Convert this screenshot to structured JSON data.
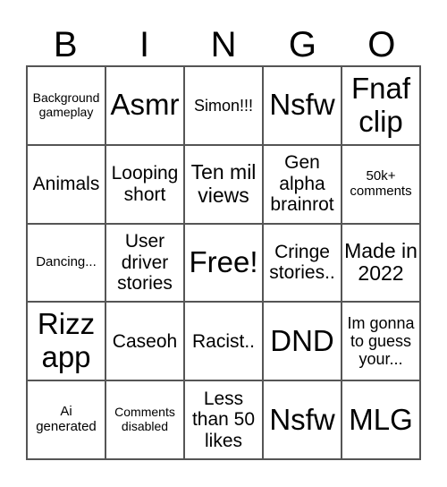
{
  "header": {
    "letters": [
      "B",
      "I",
      "N",
      "G",
      "O"
    ]
  },
  "cells": [
    [
      "Background gameplay",
      "Asmr",
      "Simon!!!",
      "Nsfw",
      "Fnaf clip"
    ],
    [
      "Animals",
      "Looping short",
      "Ten mil views",
      "Gen alpha brainrot",
      "50k+ comments"
    ],
    [
      "Dancing...",
      "User driver stories",
      "Free!",
      "Cringe stories..",
      "Made in 2022"
    ],
    [
      "Rizz app",
      "Caseoh",
      "Racist..",
      "DND",
      "Im gonna to guess your..."
    ],
    [
      "Ai generated",
      "Comments disabled",
      "Less than 50 likes",
      "Nsfw",
      "MLG"
    ]
  ]
}
